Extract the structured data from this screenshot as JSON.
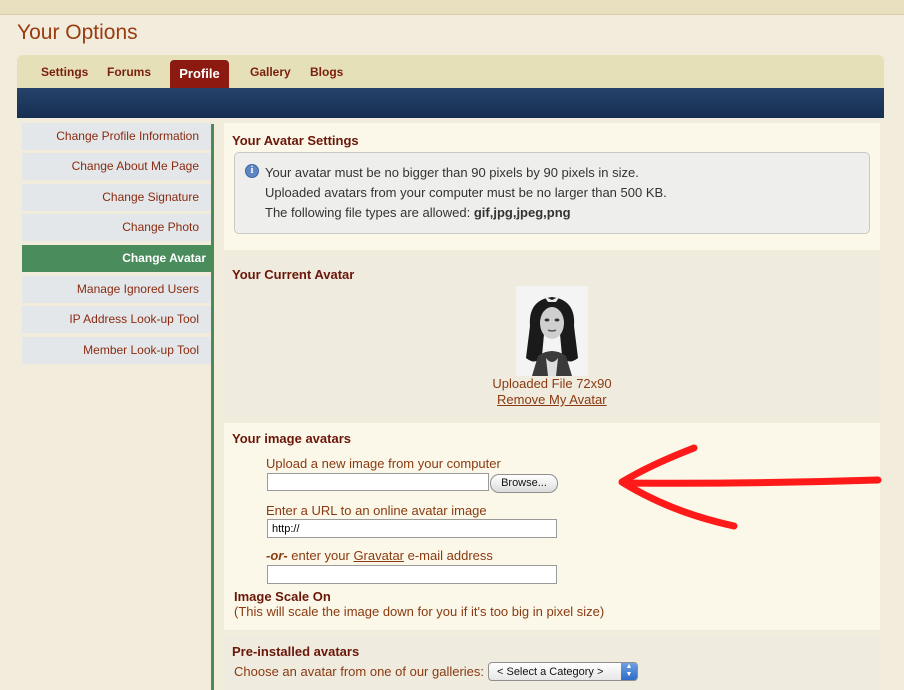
{
  "page_title": "Your Options",
  "tabs": [
    "Settings",
    "Forums",
    "Profile",
    "Gallery",
    "Blogs"
  ],
  "active_tab": "Profile",
  "sidebar": {
    "items": [
      {
        "label": "Change Profile Information"
      },
      {
        "label": "Change About Me Page"
      },
      {
        "label": "Change Signature"
      },
      {
        "label": "Change Photo"
      },
      {
        "label": "Change Avatar"
      },
      {
        "label": "Manage Ignored Users"
      },
      {
        "label": "IP Address Look-up Tool"
      },
      {
        "label": "Member Look-up Tool"
      }
    ],
    "active": "Change Avatar"
  },
  "avatar_settings": {
    "heading": "Your Avatar Settings",
    "line1": "Your avatar must be no bigger than 90 pixels by 90 pixels in size.",
    "line2": "Uploaded avatars from your computer must be no larger than 500 KB.",
    "line3_prefix": "The following file types are allowed: ",
    "line3_types": "gif,jpg,jpeg,png"
  },
  "current_avatar": {
    "heading": "Your Current Avatar",
    "caption": "Uploaded File 72x90",
    "remove_link": "Remove My Avatar"
  },
  "image_avatars": {
    "heading": "Your image avatars",
    "upload_label": "Upload a new image from your computer",
    "upload_value": "",
    "browse_button": "Browse...",
    "url_label": "Enter a URL to an online avatar image",
    "url_value": "http://",
    "gravatar_or": "-or-",
    "gravatar_pre": " enter your ",
    "gravatar_link": "Gravatar",
    "gravatar_post": " e-mail address",
    "gravatar_value": "",
    "scale_heading": "Image Scale On",
    "scale_note": "(This will scale the image down for you if it's too big in pixel size)"
  },
  "preinstalled": {
    "heading": "Pre-installed avatars",
    "choose_label": "Choose an avatar from one of our galleries:",
    "select_value": "< Select a Category >"
  },
  "colors": {
    "title": "#9a3b10",
    "active_tab": "#8c1a10",
    "navbar": "#1e385e",
    "sidebar_active": "#4b8c5c",
    "annotation_arrow": "#ff1a1a"
  },
  "icons": [
    "info-icon",
    "select-arrows-icon"
  ]
}
